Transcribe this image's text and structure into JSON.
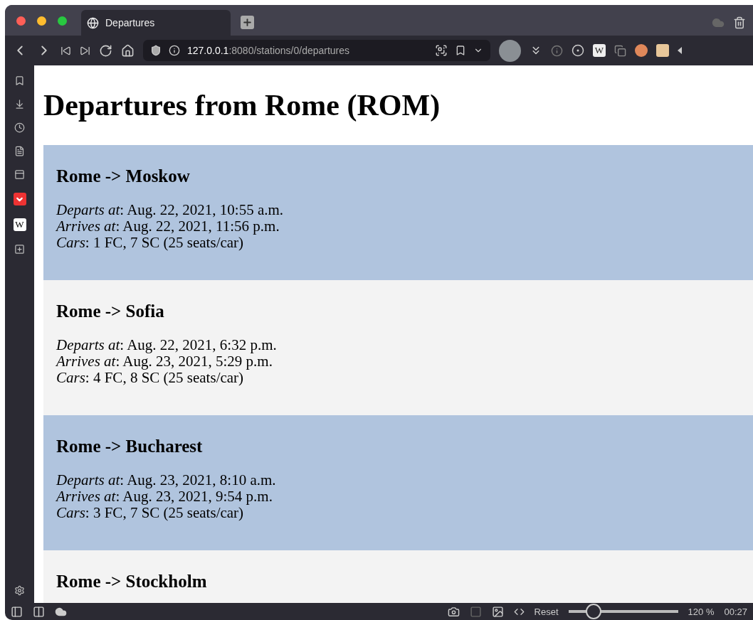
{
  "browser": {
    "tab_title": "Departures",
    "toolbar_wiki_letter": "W",
    "sidebar_wiki_letter": "W",
    "url_host": "127.0.0.1",
    "url_path": ":8080/stations/0/departures"
  },
  "page": {
    "title": "Departures from Rome (ROM)",
    "departures": [
      {
        "route": "Rome -> Moskow",
        "color": "#b0c4de",
        "lines": [
          {
            "label": "Departs at",
            "value": ": Aug. 22, 2021, 10:55 a.m."
          },
          {
            "label": "Arrives at",
            "value": ": Aug. 22, 2021, 11:56 p.m."
          },
          {
            "label": "Cars",
            "value": ": 1 FC, 7 SC (25 seats/car)"
          }
        ]
      },
      {
        "route": "Rome -> Sofia",
        "color": "#f3f3f3",
        "lines": [
          {
            "label": "Departs at",
            "value": ": Aug. 22, 2021, 6:32 p.m."
          },
          {
            "label": "Arrives at",
            "value": ": Aug. 23, 2021, 5:29 p.m."
          },
          {
            "label": "Cars",
            "value": ": 4 FC, 8 SC (25 seats/car)"
          }
        ]
      },
      {
        "route": "Rome -> Bucharest",
        "color": "#b0c4de",
        "lines": [
          {
            "label": "Departs at",
            "value": ": Aug. 23, 2021, 8:10 a.m."
          },
          {
            "label": "Arrives at",
            "value": ": Aug. 23, 2021, 9:54 p.m."
          },
          {
            "label": "Cars",
            "value": ": 3 FC, 7 SC (25 seats/car)"
          }
        ]
      },
      {
        "route": "Rome -> Stockholm",
        "color": "#f3f3f3"
      }
    ]
  },
  "status_bar": {
    "reset": "Reset",
    "zoom": {
      "level": 0.23
    },
    "zoom_reading": "120 %",
    "clock": "00:27"
  }
}
